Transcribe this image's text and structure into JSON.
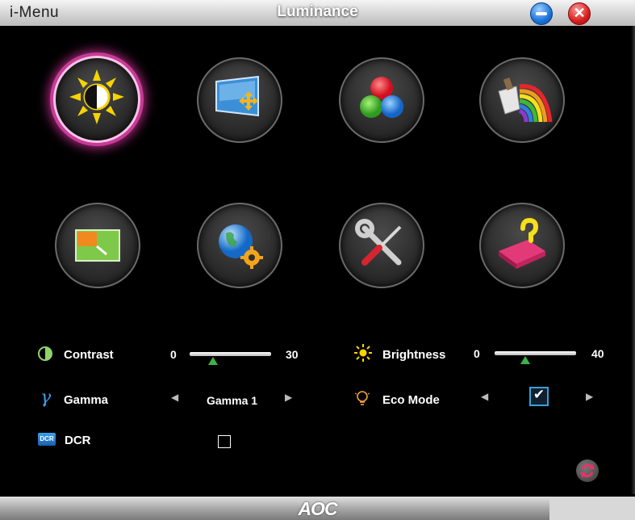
{
  "app_name": "i-Menu",
  "window_title": "Luminance",
  "brand": "AOC",
  "menu_icons": [
    {
      "id": "luminance",
      "icon": "sun-contrast-icon",
      "selected": true
    },
    {
      "id": "image-setup",
      "icon": "image-setup-icon",
      "selected": false
    },
    {
      "id": "color-temp",
      "icon": "color-balls-icon",
      "selected": false
    },
    {
      "id": "color-boost",
      "icon": "color-rainbow-icon",
      "selected": false
    },
    {
      "id": "picture-boost",
      "icon": "picture-boost-icon",
      "selected": false
    },
    {
      "id": "osd-setup",
      "icon": "globe-gear-icon",
      "selected": false
    },
    {
      "id": "extra",
      "icon": "wrench-screwdriver-icon",
      "selected": false
    },
    {
      "id": "exit",
      "icon": "exit-pad-icon",
      "selected": false
    }
  ],
  "settings": {
    "contrast": {
      "label": "Contrast",
      "min": "0",
      "max": "30",
      "value_fraction": 0.29
    },
    "brightness": {
      "label": "Brightness",
      "min": "0",
      "max": "40",
      "value_fraction": 0.38
    },
    "gamma": {
      "label": "Gamma",
      "value": "Gamma 1"
    },
    "eco_mode": {
      "label": "Eco Mode",
      "checked": true
    },
    "dcr": {
      "label": "DCR",
      "checked": false,
      "icon_text": "DCR"
    }
  },
  "colors": {
    "selected_glow": "#c93a96",
    "slider_thumb": "#3bb34a",
    "checkbox_accent": "#3aa0d8"
  }
}
